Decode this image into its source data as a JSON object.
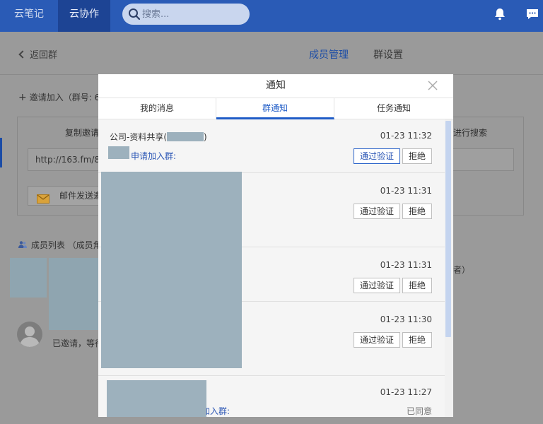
{
  "topbar": {
    "nav": [
      "云笔记",
      "云协作"
    ],
    "search_placeholder": "搜索..."
  },
  "page": {
    "back_label": "返回群",
    "tabs": [
      "成员管理",
      "群设置"
    ],
    "invite_title": "邀请加入（群号: 6",
    "copy_title": "复制邀请",
    "link_value": "http://163.fm/8C",
    "email_label": "邮件发送邀",
    "search_title": "进行搜索",
    "member_title": "成员列表 （成员角",
    "creator_note": "者）",
    "invited_text": "已邀请，等待"
  },
  "modal": {
    "title": "通知",
    "tabs": [
      "我的消息",
      "群通知",
      "任务通知"
    ],
    "items": [
      {
        "group": "公司-资料共享(",
        "group_end": ")",
        "time": "01-23 11:32",
        "apply": "申请加入群:",
        "approve": "通过验证",
        "reject": "拒绝"
      },
      {
        "time": "01-23 11:31",
        "approve": "通过验证",
        "reject": "拒绝"
      },
      {
        "time": "01-23 11:31",
        "approve": "通过验证",
        "reject": "拒绝"
      },
      {
        "time": "01-23 11:30",
        "approve": "通过验证",
        "reject": "拒绝"
      },
      {
        "group_end": ")",
        "time": "01-23 11:27",
        "apply": "加入群:",
        "status": "已同意"
      }
    ]
  },
  "colors": {
    "brand_blue": "#2a5bb6",
    "accent_blue": "#1f5cc7",
    "redaction": "#9db1bd"
  }
}
